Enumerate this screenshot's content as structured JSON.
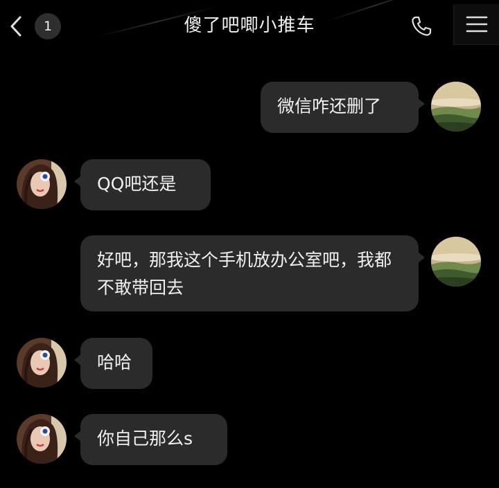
{
  "header": {
    "back_icon": "chevron-left-icon",
    "unread_count": "1",
    "title": "傻了吧唧小推车",
    "call_icon": "phone-icon",
    "menu_icon": "hamburger-menu-icon"
  },
  "colors": {
    "background": "#000000",
    "bubble": "#2b2b2b",
    "text": "#f1f1f1"
  },
  "messages": [
    {
      "sender": "me",
      "text": "微信咋还删了"
    },
    {
      "sender": "other",
      "text": "QQ吧还是"
    },
    {
      "sender": "me",
      "text": "好吧，那我这个手机放办公室吧，我都不敢带回去"
    },
    {
      "sender": "other",
      "text": "哈哈"
    },
    {
      "sender": "other",
      "text": "你自己那么s"
    }
  ]
}
